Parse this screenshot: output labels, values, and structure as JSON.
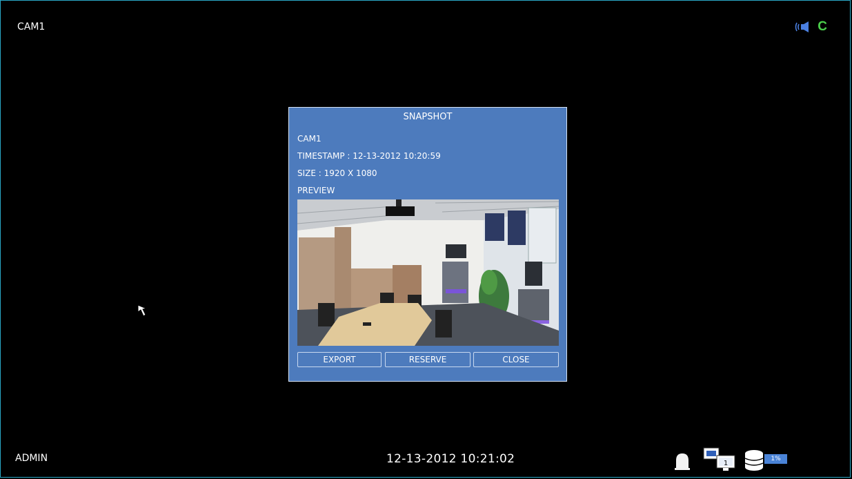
{
  "screen": {
    "camera_label": "CAM1",
    "user": "ADMIN",
    "datetime": "12-13-2012  10:21:02",
    "record_status_letter": "C"
  },
  "icons": [
    "audio-icon",
    "alarm-icon",
    "display-icon",
    "disk-icon",
    "cursor-icon"
  ],
  "status": {
    "display_channel": "1",
    "disk_usage": "1%",
    "disk_usage_fraction": 0.01
  },
  "snapshot": {
    "title": "SNAPSHOT",
    "camera": "CAM1",
    "timestamp": "TIMESTAMP :  12-13-2012  10:20:59",
    "size": "SIZE :  1920 X 1080",
    "preview_label": "PREVIEW",
    "buttons": {
      "export": "EXPORT",
      "reserve": "RESERVE",
      "close": "CLOSE"
    }
  },
  "colors": {
    "dialog_bg": "#4d7bbd",
    "frame_border": "#2aa9c8",
    "record_green": "#4bd04b",
    "audio_blue": "#4a7fe0",
    "disk_bar": "#4a83d6"
  }
}
